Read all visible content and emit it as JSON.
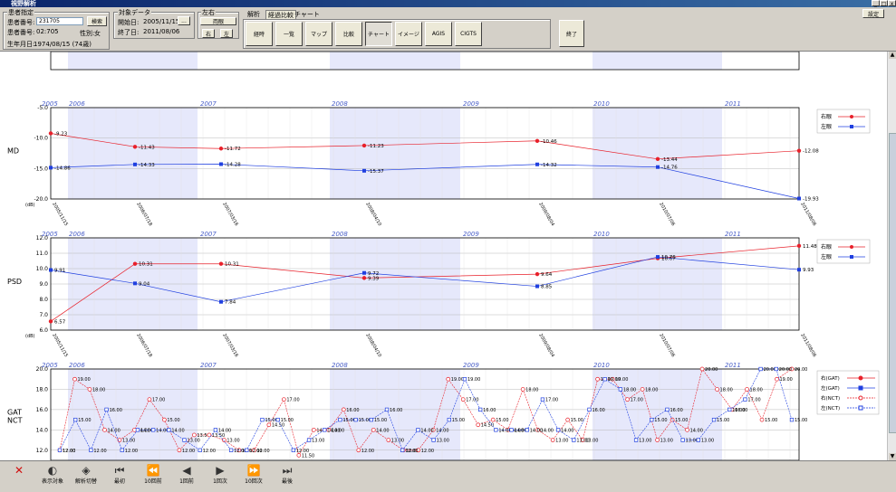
{
  "window": {
    "title": "視野解析",
    "setting_label": "設定"
  },
  "patient": {
    "group_label": "患者指定",
    "id_label": "患者番号:",
    "id_value": "231705",
    "search_label": "検索",
    "number_label": "患者番号:",
    "number_value": "02:705",
    "sex_label": "性別:",
    "sex_value": "女",
    "dob_label": "生年月日:",
    "dob_value": "1974/08/15 (74歳)"
  },
  "data_period": {
    "group_label": "対象データ",
    "start_label": "開始日:",
    "start_value": "2005/11/15",
    "end_label": "終了日:",
    "end_value": "2011/08/06",
    "picker_label": "..."
  },
  "eye": {
    "group_label": "左右",
    "both_label": "両眼",
    "right_label": "右",
    "left_label": "左"
  },
  "tabs": [
    "解析",
    "経過比較",
    "チャート"
  ],
  "view_buttons": [
    {
      "label": "経時",
      "pressed": false
    },
    {
      "label": "一覧",
      "pressed": false
    },
    {
      "label": "マップ",
      "pressed": false
    },
    {
      "label": "比較",
      "pressed": false
    },
    {
      "label": "チャート",
      "pressed": true
    },
    {
      "label": "イメージ",
      "pressed": false
    },
    {
      "label": "AGIS",
      "pressed": false
    },
    {
      "label": "CIGTS",
      "pressed": false
    }
  ],
  "exit_label": "終了",
  "bottom_nav": [
    {
      "label": "",
      "icon": "close-icon",
      "glyph": "✕"
    },
    {
      "label": "表示対象",
      "icon": "toggle-icon",
      "glyph": "◐"
    },
    {
      "label": "解析切替",
      "icon": "swap-icon",
      "glyph": "◈"
    },
    {
      "label": "最初",
      "icon": "first-icon",
      "glyph": "⏮"
    },
    {
      "label": "10回前",
      "icon": "rewind-icon",
      "glyph": "⏪"
    },
    {
      "label": "1回前",
      "icon": "prev-icon",
      "glyph": "◀"
    },
    {
      "label": "1回次",
      "icon": "next-icon",
      "glyph": "▶"
    },
    {
      "label": "10回次",
      "icon": "forward-icon",
      "glyph": "⏩"
    },
    {
      "label": "最後",
      "icon": "last-icon",
      "glyph": "⏭"
    }
  ],
  "colors": {
    "right": "#e8202a",
    "left": "#2040e0",
    "band": "#e6e8fb",
    "year_label": "#4a5fc8"
  },
  "chart_data": [
    {
      "type": "line",
      "ylabel": "MD",
      "unit": "(dB)",
      "ylim": [
        -20,
        -5
      ],
      "yticks": [
        "-5.0",
        "-10.0",
        "-15.0",
        "-20.0"
      ],
      "years": [
        "2005",
        "2006",
        "2007",
        "2008",
        "2009",
        "2010",
        "2011"
      ],
      "x_dates": [
        "2005/11/15",
        "2006/07/18",
        "2007/03/16",
        "2008/04/10",
        "2009/08/04",
        "2010/07/06",
        "2011/08/06"
      ],
      "legend": [
        "右眼",
        "左眼"
      ],
      "series": [
        {
          "name": "右眼",
          "values": [
            -9.23,
            -11.43,
            -11.72,
            -11.23,
            -10.46,
            -13.44,
            -12.08
          ],
          "labels": [
            "-9.23",
            "-11.43",
            "-11.72",
            "-11.23",
            "-10.46",
            "-13.44",
            "-12.08"
          ]
        },
        {
          "name": "左眼",
          "values": [
            -14.86,
            -14.33,
            -14.28,
            -15.37,
            -14.32,
            -14.76,
            -19.93
          ],
          "labels": [
            "-14.86",
            "-14.33",
            "-14.28",
            "-15.37",
            "-14.32",
            "-14.76",
            "-19.93"
          ]
        }
      ]
    },
    {
      "type": "line",
      "ylabel": "PSD",
      "unit": "(dB)",
      "ylim": [
        6,
        12
      ],
      "yticks": [
        "12.0",
        "11.0",
        "10.0",
        "9.0",
        "8.0",
        "7.0",
        "6.0"
      ],
      "years": [
        "2005",
        "2006",
        "2007",
        "2008",
        "2009",
        "2010",
        "2011"
      ],
      "x_dates": [
        "2005/11/15",
        "2006/07/18",
        "2007/03/16",
        "2008/04/10",
        "2009/08/04",
        "2010/07/06",
        "2011/08/06"
      ],
      "legend": [
        "右眼",
        "左眼"
      ],
      "series": [
        {
          "name": "右眼",
          "values": [
            6.57,
            10.31,
            10.31,
            9.39,
            9.64,
            10.67,
            11.48
          ],
          "labels": [
            "6.57",
            "10.31",
            "10.31",
            "9.39",
            "9.64",
            "10.67",
            "11.48"
          ]
        },
        {
          "name": "左眼",
          "values": [
            9.91,
            9.04,
            7.84,
            9.72,
            8.85,
            10.76,
            9.93
          ],
          "labels": [
            "9.91",
            "9.04",
            "7.84",
            "9.72",
            "8.85",
            "10.76",
            "9.93"
          ]
        }
      ]
    },
    {
      "type": "line",
      "ylabel": "GAT\nNCT",
      "ylim": [
        11,
        20
      ],
      "yticks": [
        "20.0",
        "18.0",
        "16.0",
        "14.0",
        "12.0"
      ],
      "years": [
        "2005",
        "2006",
        "2007",
        "2008",
        "2009",
        "2010",
        "2011"
      ],
      "legend": [
        "右(GAT)",
        "左(GAT)",
        "右(NCT)",
        "左(NCT)"
      ],
      "series": [
        {
          "name": "右(GAT)",
          "values": [
            12,
            19,
            18,
            14,
            13,
            14,
            17,
            15,
            12,
            13.5,
            13.5,
            13,
            12,
            12,
            14.5,
            17,
            11.5,
            14,
            14,
            16,
            12,
            14,
            13,
            12,
            12,
            14,
            19,
            17,
            14.5,
            15,
            14,
            18,
            14,
            13,
            15,
            13,
            19,
            19,
            17,
            18,
            13,
            15,
            14,
            20,
            18,
            16,
            18,
            15,
            19,
            20
          ]
        },
        {
          "name": "左(GAT)",
          "values": [
            12,
            15,
            12,
            16,
            12,
            14,
            14,
            14,
            13,
            12,
            14,
            12,
            12,
            15,
            15,
            12,
            13,
            14,
            15,
            15,
            15,
            16,
            12,
            14,
            13,
            15,
            19,
            16,
            14,
            14,
            14,
            17,
            14,
            13,
            16,
            19,
            18,
            13,
            15,
            16,
            13,
            13,
            15,
            16,
            17,
            20,
            20,
            15
          ]
        }
      ]
    }
  ]
}
